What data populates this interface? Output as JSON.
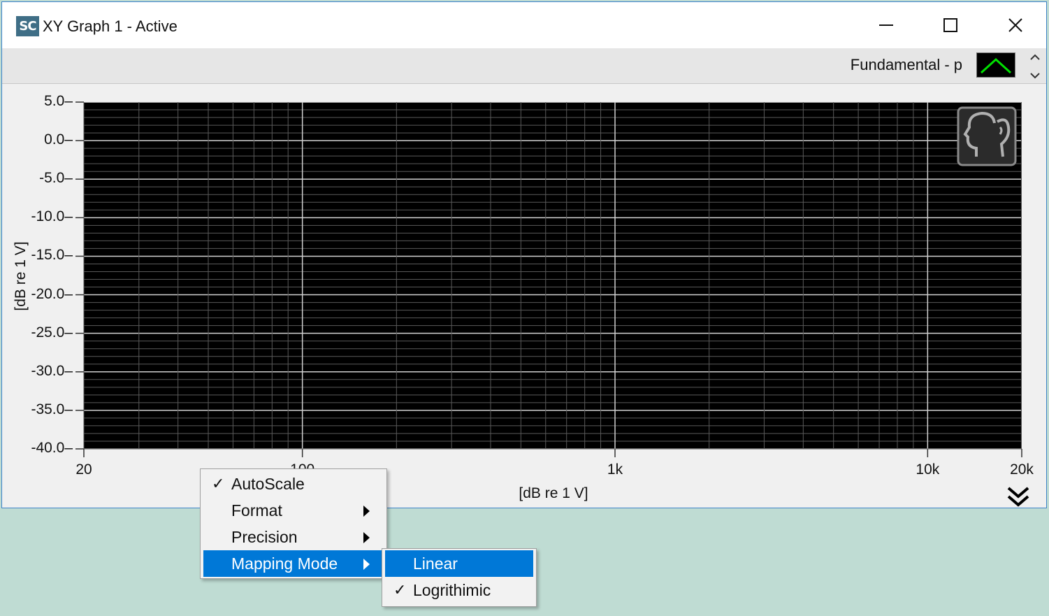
{
  "window": {
    "title": "XY Graph 1 - Active",
    "app_icon_text": "SC",
    "controls": [
      "minimize-icon",
      "maximize-icon",
      "close-icon"
    ]
  },
  "legend": {
    "plot_name": "Fundamental - p",
    "plot_color": "#00e000"
  },
  "chart_data": {
    "type": "line",
    "x_scale": "log",
    "xlabel": "[dB re 1 V]",
    "ylabel": "[dB re 1 V]",
    "xlim": [
      20,
      20000
    ],
    "ylim": [
      -40,
      5
    ],
    "x_ticks": [
      "20",
      "100",
      "1k",
      "10k",
      "20k"
    ],
    "y_ticks": [
      "5.0",
      "0.0",
      "-5.0",
      "-10.0",
      "-15.0",
      "-20.0",
      "-25.0",
      "-30.0",
      "-35.0",
      "-40.0"
    ],
    "series": [],
    "grid": true,
    "background": "#000000",
    "grid_major_color": "#d0d0d0",
    "grid_minor_color": "#5a5a5a"
  },
  "context_menu": {
    "items": [
      {
        "label": "AutoScale",
        "checked": true,
        "submenu": false
      },
      {
        "label": "Format",
        "checked": false,
        "submenu": true
      },
      {
        "label": "Precision",
        "checked": false,
        "submenu": true
      },
      {
        "label": "Mapping Mode",
        "checked": false,
        "submenu": true,
        "highlighted": true
      }
    ],
    "check_glyph": "✓"
  },
  "submenu": {
    "items": [
      {
        "label": "Linear",
        "checked": false,
        "highlighted": true
      },
      {
        "label": "Logrithimic",
        "checked": true
      }
    ]
  },
  "colors": {
    "selection": "#0078d7",
    "desktop": "#bfdcd3",
    "window_border": "#3c82c8"
  }
}
